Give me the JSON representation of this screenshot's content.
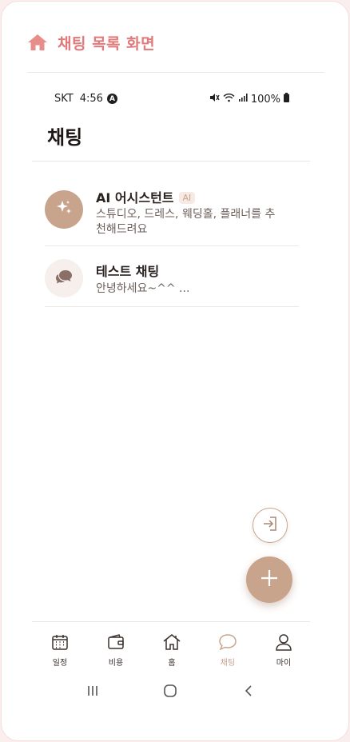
{
  "page_header": {
    "title": "채팅 목록 화면",
    "icon": "home-icon",
    "accent": "#e07a7a"
  },
  "status_bar": {
    "carrier": "SKT",
    "time": "4:56",
    "nav_badge": "A",
    "battery": "100%"
  },
  "screen": {
    "title": "채팅"
  },
  "chats": [
    {
      "name": "AI 어시스턴트",
      "badge": "AI",
      "preview": "스튜디오, 드레스, 웨딩홀, 플래너를 추천해드려요",
      "avatar_icon": "sparkles-icon"
    },
    {
      "name": "테스트 채팅",
      "preview": "안녕하세요~^^ ...",
      "avatar_icon": "chat-bubbles-icon"
    }
  ],
  "fabs": {
    "small_icon": "login-icon",
    "main_icon": "plus-icon"
  },
  "tab_bar": {
    "active": "채팅",
    "tabs": [
      {
        "label": "일정",
        "icon": "calendar-icon"
      },
      {
        "label": "비용",
        "icon": "wallet-icon"
      },
      {
        "label": "홈",
        "icon": "home-icon"
      },
      {
        "label": "채팅",
        "icon": "chat-icon"
      },
      {
        "label": "마이",
        "icon": "user-icon"
      }
    ]
  },
  "colors": {
    "brand": "#c9a48c",
    "text": "#2a2220",
    "muted": "#6c5f5a"
  }
}
